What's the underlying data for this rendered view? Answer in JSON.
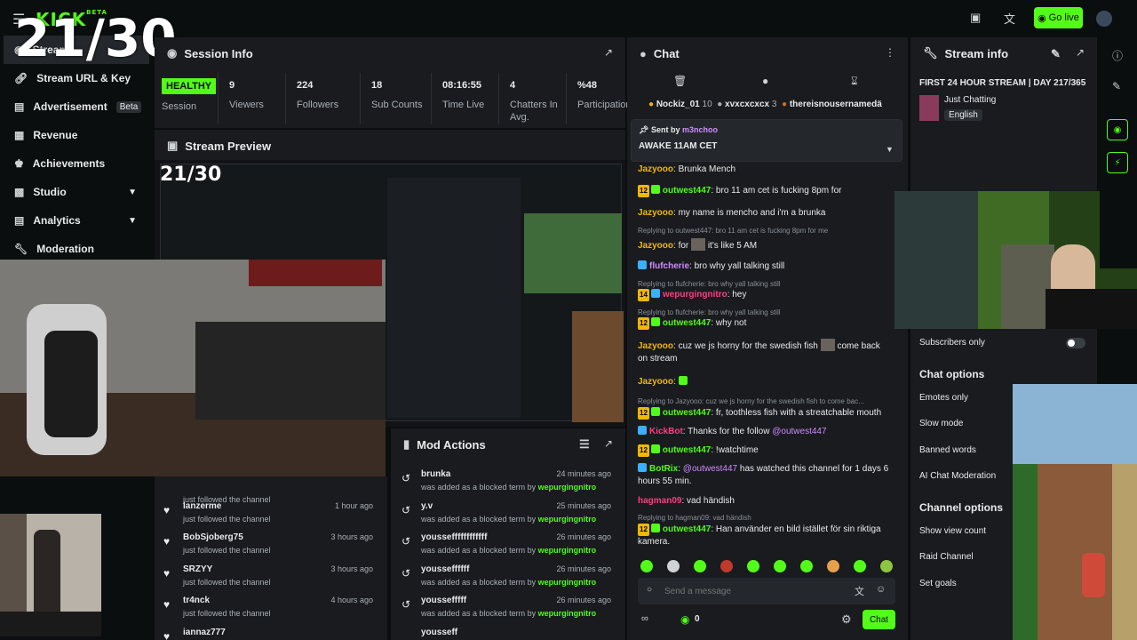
{
  "topbar": {
    "logo": "KICK",
    "logo_beta": "BETA",
    "overlay_count": "21/30",
    "go_live": "Go live"
  },
  "sidebar": {
    "items": [
      {
        "label": "Stream",
        "icon": "stream-icon"
      },
      {
        "label": "Stream URL & Key",
        "icon": "link-icon"
      },
      {
        "label": "Advertisement",
        "badge": "Beta",
        "icon": "ad-icon"
      },
      {
        "label": "Revenue",
        "icon": "revenue-icon"
      },
      {
        "label": "Achievements",
        "icon": "trophy-icon"
      },
      {
        "label": "Studio",
        "icon": "studio-icon"
      },
      {
        "label": "Analytics",
        "icon": "analytics-icon"
      },
      {
        "label": "Moderation",
        "icon": "wrench-icon"
      }
    ]
  },
  "session": {
    "title": "Session Info",
    "status": "HEALTHY",
    "status_label": "Session",
    "stats": [
      {
        "value": "9",
        "label": "Viewers"
      },
      {
        "value": "224",
        "label": "Followers"
      },
      {
        "value": "18",
        "label": "Sub Counts"
      },
      {
        "value": "08:16:55",
        "label": "Time Live"
      },
      {
        "value": "4",
        "label": "Chatters In",
        "label2": "Avg."
      },
      {
        "value": "%48",
        "label": "Participation"
      }
    ]
  },
  "preview": {
    "title": "Stream Preview"
  },
  "follows": {
    "items": [
      {
        "name": "",
        "status": "just followed the channel",
        "time": ""
      },
      {
        "name": "lanzerme",
        "status": "just followed the channel",
        "time": "1 hour ago"
      },
      {
        "name": "BobSjoberg75",
        "status": "just followed the channel",
        "time": "3 hours ago"
      },
      {
        "name": "SRZYY",
        "status": "just followed the channel",
        "time": "3 hours ago"
      },
      {
        "name": "tr4nck",
        "status": "just followed the channel",
        "time": "4 hours ago"
      },
      {
        "name": "iannaz777",
        "status": "",
        "time": ""
      }
    ]
  },
  "mod_actions": {
    "title": "Mod Actions",
    "items": [
      {
        "term": "brunka",
        "action": "was added as a blocked term by",
        "by": "wepurgingnitro",
        "time": "24 minutes ago"
      },
      {
        "term": "y.v",
        "action": "was added as a blocked term by",
        "by": "wepurgingnitro",
        "time": "25 minutes ago"
      },
      {
        "term": "yousseffffffffffff",
        "action": "was added as a blocked term by",
        "by": "wepurgingnitro",
        "time": "26 minutes ago"
      },
      {
        "term": "yousseffffff",
        "action": "was added as a blocked term by",
        "by": "wepurgingnitro",
        "time": "26 minutes ago"
      },
      {
        "term": "youssefffff",
        "action": "was added as a blocked term by",
        "by": "wepurgingnitro",
        "time": "26 minutes ago"
      },
      {
        "term": "yousseff",
        "action": "",
        "by": "",
        "time": ""
      }
    ]
  },
  "chat": {
    "title": "Chat",
    "top_chatters": [
      {
        "name": "Nockiz_01",
        "count": "10"
      },
      {
        "name": "xvxcxcxcx",
        "count": "3"
      },
      {
        "name": "thereisnousernamedä"
      }
    ],
    "pinned": {
      "sent_by_label": "Sent by",
      "sent_by": "m3nchoo",
      "text": "AWAKE 11AM CET"
    },
    "messages": [
      {
        "user": "Jazyooo",
        "text": ": Brunka Mench",
        "color": "#f2b705"
      },
      {
        "user": "outwest447",
        "badge": "12",
        "text": ": bro 11 am cet is fucking 8pm for",
        "color": "#53fc18"
      },
      {
        "user": "Jazyooo",
        "text": ": my name is mencho and i'm a brunka",
        "color": "#f2b705"
      },
      {
        "reply": "Replying to outwest447: bro 11 am cet is fucking 8pm for me"
      },
      {
        "user": "Jazyooo",
        "text": ": for",
        "text2": "it's like 5 AM",
        "color": "#f2b705"
      },
      {
        "user": "flufcherie",
        "text": ": bro why yall talking still",
        "color": "#d08cff"
      },
      {
        "reply": "Replying to flufcherie: bro why yall talking still"
      },
      {
        "user": "wepurgingnitro",
        "badge": "14",
        "text": ": hey",
        "color": "#ff3d7f"
      },
      {
        "reply": "Replying to flufcherie: bro why yall talking still"
      },
      {
        "user": "outwest447",
        "badge": "12",
        "text": ": why not",
        "color": "#53fc18"
      },
      {
        "user": "Jazyooo",
        "text": ": cuz we js horny for the swedish fish",
        "text2": "come back on stream",
        "color": "#f2b705"
      },
      {
        "user": "Jazyooo",
        "text": ":",
        "color": "#f2b705"
      },
      {
        "reply": "Replying to Jazyooo: cuz we js horny for the swedish fish to come bac..."
      },
      {
        "user": "outwest447",
        "badge": "12",
        "text": ": fr, toothless fish with a streatchable mouth",
        "color": "#53fc18"
      },
      {
        "user": "KickBot",
        "text": ": Thanks for the follow",
        "mention": "@outwest447",
        "color": "#ff3d7f"
      },
      {
        "user": "outwest447",
        "badge": "12",
        "text": ": !watchtime",
        "color": "#53fc18"
      },
      {
        "user": "BotRix",
        "text": ":",
        "mention": "@outwest447",
        "text2": "has watched this channel for 1 days 6 hours 55 min.",
        "color": "#53fc18"
      },
      {
        "user": "hagman09",
        "text": ": vad händish",
        "color": "#ff3d7f"
      },
      {
        "reply": "Replying to hagman09: vad händish"
      },
      {
        "user": "outwest447",
        "badge": "12",
        "text": ": Han använder en bild istället för sin riktiga kamera.",
        "color": "#53fc18"
      }
    ],
    "input_placeholder": "Send a message",
    "points": "0",
    "send_label": "Chat"
  },
  "stream_info": {
    "title": "Stream info",
    "stream_title": "FIRST 24 HOUR STREAM | DAY 217/365",
    "category": "Just Chatting",
    "language": "English",
    "subscribers_only": "Subscribers only",
    "chat_options_title": "Chat options",
    "chat_options": [
      "Emotes only",
      "Slow mode",
      "Banned words",
      "AI Chat Moderation"
    ],
    "channel_options_title": "Channel options",
    "channel_options": [
      "Show view count",
      "Raid Channel",
      "Set goals"
    ]
  },
  "colors": {
    "accent": "#53fc18",
    "panel": "#191b1f",
    "bg": "#0b0e0f"
  }
}
